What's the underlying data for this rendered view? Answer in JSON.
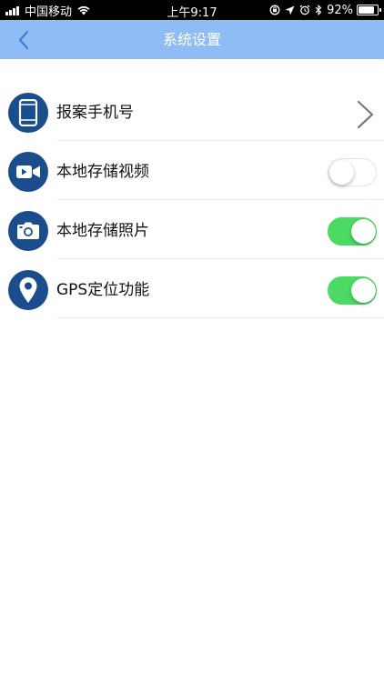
{
  "status_bar": {
    "carrier": "中国移动",
    "time": "上午9:17",
    "battery_percent": "92%",
    "battery_level": 0.92,
    "icons": [
      "signal-icon",
      "wifi-icon",
      "orientation-lock-icon",
      "location-arrow-icon",
      "alarm-icon",
      "bluetooth-icon",
      "battery-icon"
    ]
  },
  "nav": {
    "title": "系统设置",
    "back_icon": "chevron-left-icon"
  },
  "settings": {
    "items": [
      {
        "label": "报案手机号",
        "icon": "phone-icon",
        "control": "chevron"
      },
      {
        "label": "本地存储视频",
        "icon": "video-camera-icon",
        "control": "toggle",
        "on": false
      },
      {
        "label": "本地存储照片",
        "icon": "camera-icon",
        "control": "toggle",
        "on": true
      },
      {
        "label": "GPS定位功能",
        "icon": "location-pin-icon",
        "control": "toggle",
        "on": true
      }
    ]
  },
  "colors": {
    "nav_bar": "#8fbcf4",
    "icon_circle": "#1b4c8c",
    "toggle_on": "#4cd964",
    "status_bar": "#000000"
  }
}
